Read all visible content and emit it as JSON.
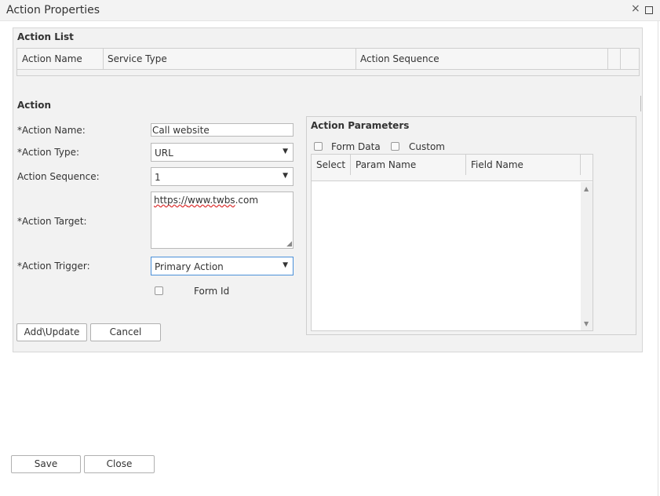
{
  "window": {
    "title": "Action Properties",
    "close_icon": "×"
  },
  "action_list": {
    "heading": "Action List",
    "columns": [
      "Action Name",
      "Service Type",
      "Action Sequence"
    ]
  },
  "action": {
    "heading": "Action",
    "name_label": "*Action Name:",
    "name_value": "Call website",
    "type_label": "*Action Type:",
    "type_value": "URL",
    "sequence_label": "Action Sequence:",
    "sequence_value": "1",
    "target_label": "*Action Target:",
    "target_value_prefix": "https://",
    "target_value_spell": "www.twbs",
    "target_value_suffix": ".com",
    "trigger_label": "*Action Trigger:",
    "trigger_value": "Primary Action",
    "form_id_label": "Form Id",
    "add_update_label": "Add\\Update",
    "cancel_label": "Cancel"
  },
  "params": {
    "heading": "Action Parameters",
    "form_data_label": "Form Data",
    "custom_label": "Custom",
    "columns": [
      "Select",
      "Param Name",
      "Field Name"
    ]
  },
  "footer": {
    "save_label": "Save",
    "close_label": "Close"
  },
  "icons": {
    "dropdown": "▼",
    "scroll_up": "▲",
    "scroll_down": "▼"
  },
  "colors": {
    "panel_bg": "#f2f2f2",
    "trigger_border": "#4a90d9"
  }
}
